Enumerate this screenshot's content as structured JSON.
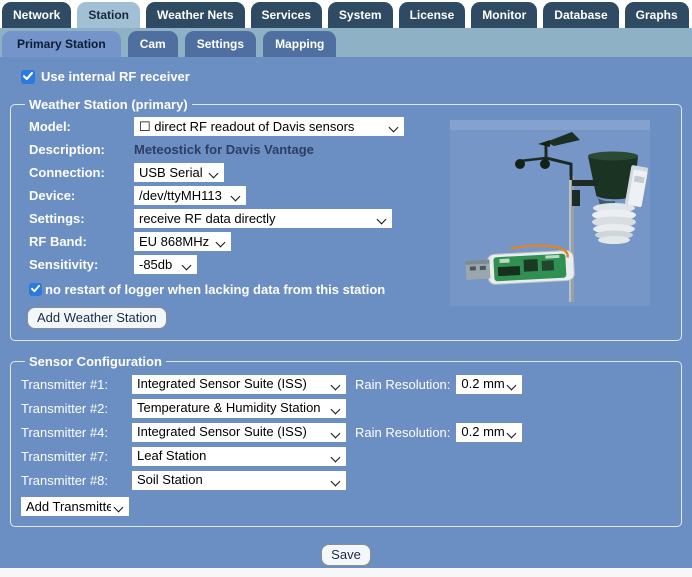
{
  "colors": {
    "page_bg": "#6b8ec3",
    "nav_tab_bg": "#2e4b63",
    "nav_tab_active_bg": "#a2c0d4",
    "subnav_strip_bg": "#8fb1c5",
    "subnav_tab_bg": "#4f6fa1",
    "subnav_tab_active_bg": "#7494ca",
    "checkbox_accent": "#2a7ae2",
    "select_bg": "#ffffff",
    "footer_strip_bg": "#f7f7f7"
  },
  "nav": {
    "tabs": [
      "Network",
      "Station",
      "Weather Nets",
      "Services",
      "System",
      "License",
      "Monitor",
      "Database",
      "Graphs"
    ],
    "active": "Station"
  },
  "subnav": {
    "tabs": [
      "Primary Station",
      "Cam",
      "Settings",
      "Mapping"
    ],
    "active": "Primary Station"
  },
  "station_form": {
    "use_internal_rf": {
      "label": "Use internal RF receiver",
      "checked": true
    },
    "weather_station": {
      "legend": "Weather Station (primary)",
      "model": {
        "label": "Model:",
        "value": "☐ direct RF readout of Davis sensors"
      },
      "description": {
        "label": "Description:",
        "value": "Meteostick for Davis Vantage"
      },
      "connection": {
        "label": "Connection:",
        "value": "USB Serial"
      },
      "device": {
        "label": "Device:",
        "value": "/dev/ttyMH113"
      },
      "settings": {
        "label": "Settings:",
        "value": "receive RF data directly"
      },
      "rf_band": {
        "label": "RF Band:",
        "value": "EU 868MHz"
      },
      "sensitivity": {
        "label": "Sensitivity:",
        "value": "-85db"
      },
      "no_restart": {
        "label": "no restart of logger when lacking data from this station",
        "checked": true
      },
      "add_button": "Add Weather Station",
      "photo": "davis-vantage-iss-with-meteostick-usb-receiver"
    },
    "sensor_configuration": {
      "legend": "Sensor Configuration",
      "rain_resolution_label": "Rain Resolution:",
      "transmitters": [
        {
          "label": "Transmitter #1:",
          "value": "Integrated Sensor Suite (ISS)",
          "rain_resolution": "0.2 mm"
        },
        {
          "label": "Transmitter #2:",
          "value": "Temperature & Humidity Station"
        },
        {
          "label": "Transmitter #4:",
          "value": "Integrated Sensor Suite (ISS)",
          "rain_resolution": "0.2 mm"
        },
        {
          "label": "Transmitter #7:",
          "value": "Leaf Station"
        },
        {
          "label": "Transmitter #8:",
          "value": "Soil Station"
        }
      ],
      "add_transmitter": "Add Transmitter"
    },
    "save_button": "Save"
  }
}
